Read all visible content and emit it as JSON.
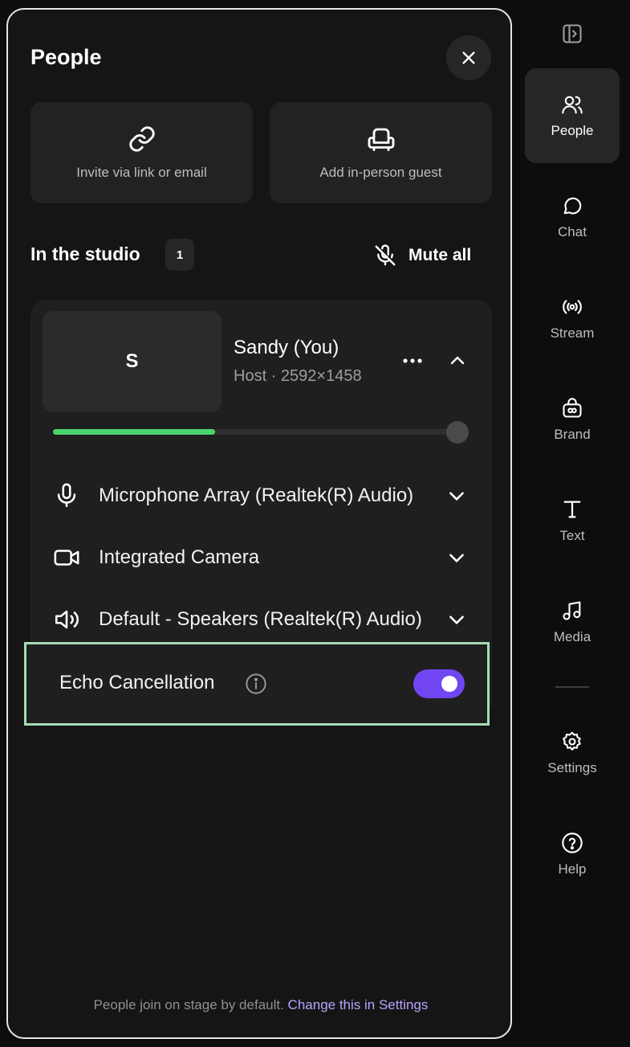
{
  "panel": {
    "title": "People",
    "actions": [
      {
        "label": "Invite via link or email",
        "icon": "link-icon"
      },
      {
        "label": "Add in-person guest",
        "icon": "armchair-icon"
      }
    ],
    "studio": {
      "title": "In the studio",
      "count": "1",
      "mute_all_label": "Mute all"
    },
    "participant": {
      "initial": "S",
      "name": "Sandy (You)",
      "role": "Host · 2592×1458",
      "volume_level": 0.4
    },
    "devices": [
      {
        "label": "Microphone Array (Realtek(R) Audio)",
        "icon": "microphone-icon"
      },
      {
        "label": "Integrated Camera",
        "icon": "camera-icon"
      },
      {
        "label": "Default - Speakers (Realtek(R) Audio)",
        "icon": "speaker-icon"
      }
    ],
    "echo": {
      "label": "Echo Cancellation",
      "enabled": true
    },
    "footer": {
      "text": "People join on stage by default. ",
      "link": "Change this in Settings"
    }
  },
  "rail": {
    "items": [
      {
        "label": "People",
        "icon": "people-icon",
        "active": true
      },
      {
        "label": "Chat",
        "icon": "chat-icon"
      },
      {
        "label": "Stream",
        "icon": "broadcast-icon"
      },
      {
        "label": "Brand",
        "icon": "brand-icon"
      },
      {
        "label": "Text",
        "icon": "text-icon"
      },
      {
        "label": "Media",
        "icon": "music-note-icon"
      },
      {
        "label": "Settings",
        "icon": "gear-icon"
      },
      {
        "label": "Help",
        "icon": "help-icon"
      }
    ]
  },
  "colors": {
    "accent": "#7146f2",
    "volume": "#4cd471",
    "link": "#b9a3ff",
    "highlight": "#a6dcb5"
  }
}
